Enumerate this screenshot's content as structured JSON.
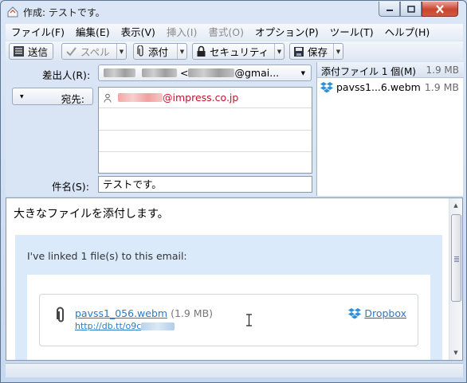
{
  "window": {
    "title": "作成: テストです。"
  },
  "menu": [
    {
      "label": "ファイル(F)",
      "disabled": false
    },
    {
      "label": "編集(E)",
      "disabled": false
    },
    {
      "label": "表示(V)",
      "disabled": false
    },
    {
      "label": "挿入(I)",
      "disabled": true
    },
    {
      "label": "書式(O)",
      "disabled": true
    },
    {
      "label": "オプション(P)",
      "disabled": false
    },
    {
      "label": "ツール(T)",
      "disabled": false
    },
    {
      "label": "ヘルプ(H)",
      "disabled": false
    }
  ],
  "toolbar": {
    "send": "送信",
    "spell": "スペル",
    "attach": "添付",
    "security": "セキュリティ",
    "save": "保存"
  },
  "header": {
    "from_label": "差出人(R):",
    "from_value_visible": "@gmai...",
    "to_type_label": "宛先:",
    "recipient_visible": "@impress.co.jp",
    "subject_label": "件名(S):",
    "subject_value": "テストです。"
  },
  "attachments": {
    "header_label": "添付ファイル 1 個(M)",
    "total_size": "1.9 MB",
    "items": [
      {
        "name": "pavss1...6.webm",
        "size": "1.9 MB"
      }
    ]
  },
  "body": {
    "first_line": "大きなファイルを添付します。",
    "intro": "I've linked 1 file(s) to this email:",
    "file_name": "pavss1_056.webm",
    "file_size": "(1.9 MB)",
    "url_prefix": "http://db.tt/o9c",
    "dropbox_label": "Dropbox"
  },
  "colors": {
    "link": "#2a79c9",
    "recipient": "#c8102e",
    "link_box_bg": "#dbeafa"
  }
}
